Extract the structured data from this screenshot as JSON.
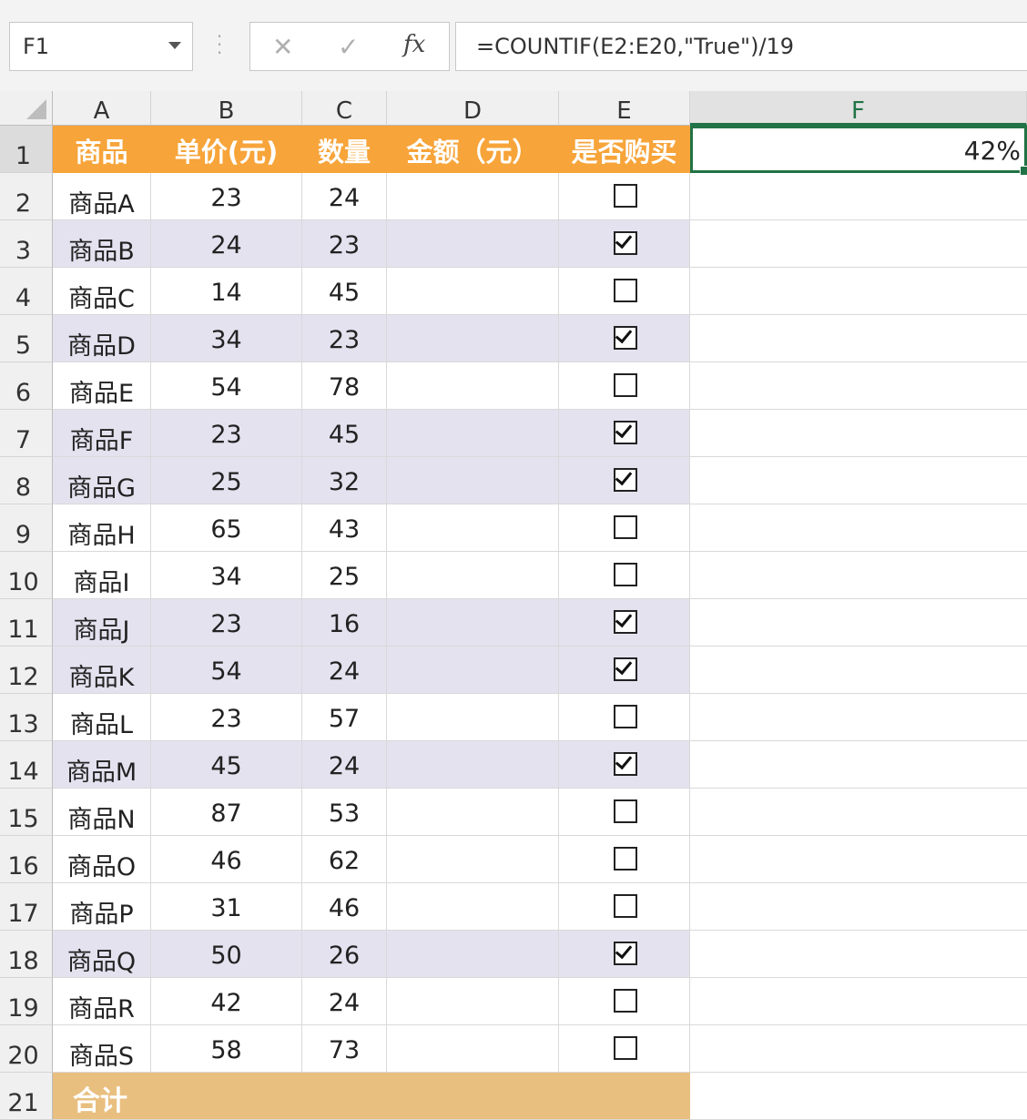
{
  "namebox": {
    "value": "F1"
  },
  "formula_buttons": {
    "cancel": "✕",
    "enter": "✓",
    "fx": "fx"
  },
  "formula_bar": {
    "value": "=COUNTIF(E2:E20,\"True\")/19"
  },
  "columns": [
    "A",
    "B",
    "C",
    "D",
    "E",
    "F"
  ],
  "selected_column": "F",
  "header_row": {
    "product": "商品",
    "price": "单价(元)",
    "qty": "数量",
    "amount": "金额（元）",
    "bought": "是否购买"
  },
  "rows": [
    {
      "product": "商品A",
      "price": "23",
      "qty": "24",
      "bought": false
    },
    {
      "product": "商品B",
      "price": "24",
      "qty": "23",
      "bought": true
    },
    {
      "product": "商品C",
      "price": "14",
      "qty": "45",
      "bought": false
    },
    {
      "product": "商品D",
      "price": "34",
      "qty": "23",
      "bought": true
    },
    {
      "product": "商品E",
      "price": "54",
      "qty": "78",
      "bought": false
    },
    {
      "product": "商品F",
      "price": "23",
      "qty": "45",
      "bought": true
    },
    {
      "product": "商品G",
      "price": "25",
      "qty": "32",
      "bought": true
    },
    {
      "product": "商品H",
      "price": "65",
      "qty": "43",
      "bought": false
    },
    {
      "product": "商品I",
      "price": "34",
      "qty": "25",
      "bought": false
    },
    {
      "product": "商品J",
      "price": "23",
      "qty": "16",
      "bought": true
    },
    {
      "product": "商品K",
      "price": "54",
      "qty": "24",
      "bought": true
    },
    {
      "product": "商品L",
      "price": "23",
      "qty": "57",
      "bought": false
    },
    {
      "product": "商品M",
      "price": "45",
      "qty": "24",
      "bought": true
    },
    {
      "product": "商品N",
      "price": "87",
      "qty": "53",
      "bought": false
    },
    {
      "product": "商品O",
      "price": "46",
      "qty": "62",
      "bought": false
    },
    {
      "product": "商品P",
      "price": "31",
      "qty": "46",
      "bought": false
    },
    {
      "product": "商品Q",
      "price": "50",
      "qty": "26",
      "bought": true
    },
    {
      "product": "商品R",
      "price": "42",
      "qty": "24",
      "bought": false
    },
    {
      "product": "商品S",
      "price": "58",
      "qty": "73",
      "bought": false
    }
  ],
  "total_row": {
    "label": "合计"
  },
  "f1_value": "42%",
  "colors": {
    "header_bg": "#f7a43a",
    "alt_row_bg": "#e4e2ef",
    "total_bg": "#e9bf80",
    "selection": "#217346"
  }
}
